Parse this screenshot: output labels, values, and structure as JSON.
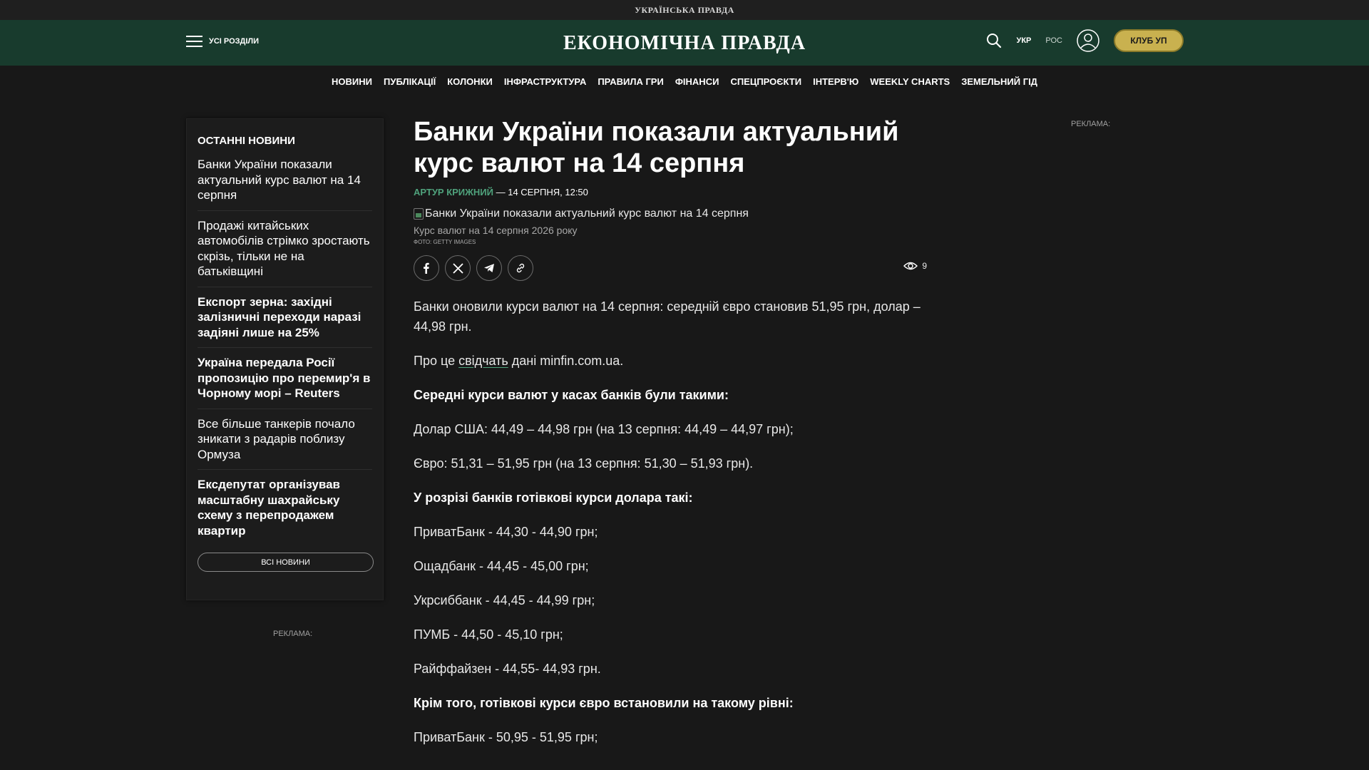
{
  "topbar": {
    "logo": "УКРАЇНСЬКА ПРАВДА"
  },
  "header": {
    "menu_label": "УСІ РОЗДІЛИ",
    "logo": "ЕКОНОМІЧНА ПРАВДА",
    "lang_ukr": "УКР",
    "lang_ros": "РОС",
    "club_label": "КЛУБ УП"
  },
  "nav": {
    "items": [
      "НОВИНИ",
      "ПУБЛІКАЦІЇ",
      "КОЛОНКИ",
      "ІНФРАСТРУКТУРА",
      "ПРАВИЛА ГРИ",
      "ФІНАНСИ",
      "СПЕЦПРОЄКТИ",
      "ІНТЕРВ'Ю",
      "WEEKLY CHARTS",
      "ЗЕМЕЛЬНИЙ ГІД"
    ]
  },
  "sidebar": {
    "title": "ОСТАННІ НОВИНИ",
    "items": [
      "Банки України показали актуальний курс валют на 14 серпня",
      "Продажі китайських автомобілів стрімко зростають скрізь, тільки не на батьківщині",
      "Експорт зерна: західні залізничні переходи наразі задіяні лише на 25%",
      "Україна передала Росії пропозицію про перемир'я в Чорному морі – Reuters",
      "Все більше танкерів почало зникати з радарів поблизу Ормуза",
      "Ексдепутат організував масштабну шахрайську схему з перепродажем квартир"
    ],
    "all_news": "ВСІ НОВИНИ"
  },
  "ads": {
    "label": "РЕКЛАМА:"
  },
  "article": {
    "title": "Банки України показали актуальний курс валют на 14 серпня",
    "author": "АРТУР КРИЖНИЙ",
    "date": " — 14 СЕРПНЯ, 12:50",
    "image_alt": "Банки України показали актуальний курс валют на 14 серпня",
    "caption": "Курс валют на 14 серпня 2026 року",
    "credit": "ФОТО: GETTY IMAGES",
    "views": "9",
    "lead": "Банки оновили курси валют на 14 серпня: середній євро становив 51,95 грн, долар – 44,98 грн.",
    "source_prefix": "Про це ",
    "source_link": "свідчать",
    "source_suffix": " дані minfin.com.ua.",
    "avg_heading": "Середні курси валют у касах банків були такими:",
    "usd_line": "Долар США: 44,49 – 44,98 грн (на 13 серпня: 44,49 – 44,97 грн);",
    "eur_line": "Євро: 51,31 – 51,95 грн (на 13 серпня: 51,30 – 51,93 грн).",
    "usd_banks_heading": "У розрізі банків готівкові курси долара такі:",
    "usd_banks": [
      "ПриватБанк - 44,30 - 44,90 грн;",
      "Ощадбанк - 44,45 - 45,00 грн;",
      "Укрсиббанк - 44,45 - 44,99 грн;",
      "ПУМБ - 44,50 - 45,10 грн;",
      "Райффайзен - 44,55- 44,93 грн."
    ],
    "eur_banks_heading": "Крім того, готівкові курси євро встановили на такому рівні:",
    "eur_banks": [
      "ПриватБанк - 50,95 - 51,95 грн;"
    ]
  }
}
